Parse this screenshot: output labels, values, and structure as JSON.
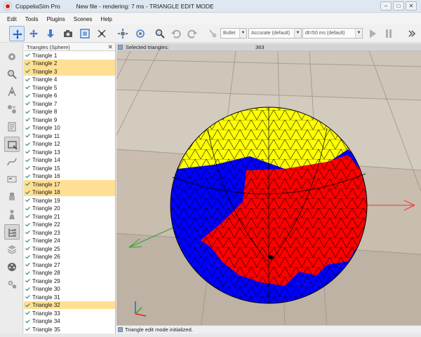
{
  "window": {
    "app_name": "CoppeliaSim Pro",
    "file_status": "New file - rendering: 7 ms - TRIANGLE EDIT MODE",
    "controls": [
      "–",
      "□",
      "✕"
    ]
  },
  "menubar": [
    "Edit",
    "Tools",
    "Plugins",
    "Scenes",
    "Help"
  ],
  "toolbar": {
    "physics_engine": "Bullet",
    "accuracy": "Accurate (default)",
    "timestep": "dt=50 ms (default)"
  },
  "triangle_list": {
    "header": "Triangles (Sphere)",
    "close": "✕",
    "items": [
      {
        "label": "Triangle 1",
        "selected": false
      },
      {
        "label": "Triangle 2",
        "selected": true
      },
      {
        "label": "Triangle 3",
        "selected": true
      },
      {
        "label": "Triangle 4",
        "selected": false
      },
      {
        "label": "Triangle 5",
        "selected": false
      },
      {
        "label": "Triangle 6",
        "selected": false
      },
      {
        "label": "Triangle 7",
        "selected": false
      },
      {
        "label": "Triangle 8",
        "selected": false
      },
      {
        "label": "Triangle 9",
        "selected": false
      },
      {
        "label": "Triangle 10",
        "selected": false
      },
      {
        "label": "Triangle 11",
        "selected": false
      },
      {
        "label": "Triangle 12",
        "selected": false
      },
      {
        "label": "Triangle 13",
        "selected": false
      },
      {
        "label": "Triangle 14",
        "selected": false
      },
      {
        "label": "Triangle 15",
        "selected": false
      },
      {
        "label": "Triangle 16",
        "selected": false
      },
      {
        "label": "Triangle 17",
        "selected": true
      },
      {
        "label": "Triangle 18",
        "selected": true
      },
      {
        "label": "Triangle 19",
        "selected": false
      },
      {
        "label": "Triangle 20",
        "selected": false
      },
      {
        "label": "Triangle 21",
        "selected": false
      },
      {
        "label": "Triangle 22",
        "selected": false
      },
      {
        "label": "Triangle 23",
        "selected": false
      },
      {
        "label": "Triangle 24",
        "selected": false
      },
      {
        "label": "Triangle 25",
        "selected": false
      },
      {
        "label": "Triangle 26",
        "selected": false
      },
      {
        "label": "Triangle 27",
        "selected": false
      },
      {
        "label": "Triangle 28",
        "selected": false
      },
      {
        "label": "Triangle 29",
        "selected": false
      },
      {
        "label": "Triangle 30",
        "selected": false
      },
      {
        "label": "Triangle 31",
        "selected": false
      },
      {
        "label": "Triangle 32",
        "selected": true
      },
      {
        "label": "Triangle 33",
        "selected": false
      },
      {
        "label": "Triangle 34",
        "selected": false
      },
      {
        "label": "Triangle 35",
        "selected": false
      }
    ]
  },
  "viewport": {
    "selected_triangles_label": "Selected triangles:",
    "selected_triangles_count": "363",
    "status_message": "Triangle edit mode initialized."
  },
  "colors": {
    "selection_highlight": "#ffdf93",
    "sphere_yellow": "#ffff00",
    "sphere_blue": "#0000ff",
    "sphere_red": "#ff0000"
  }
}
